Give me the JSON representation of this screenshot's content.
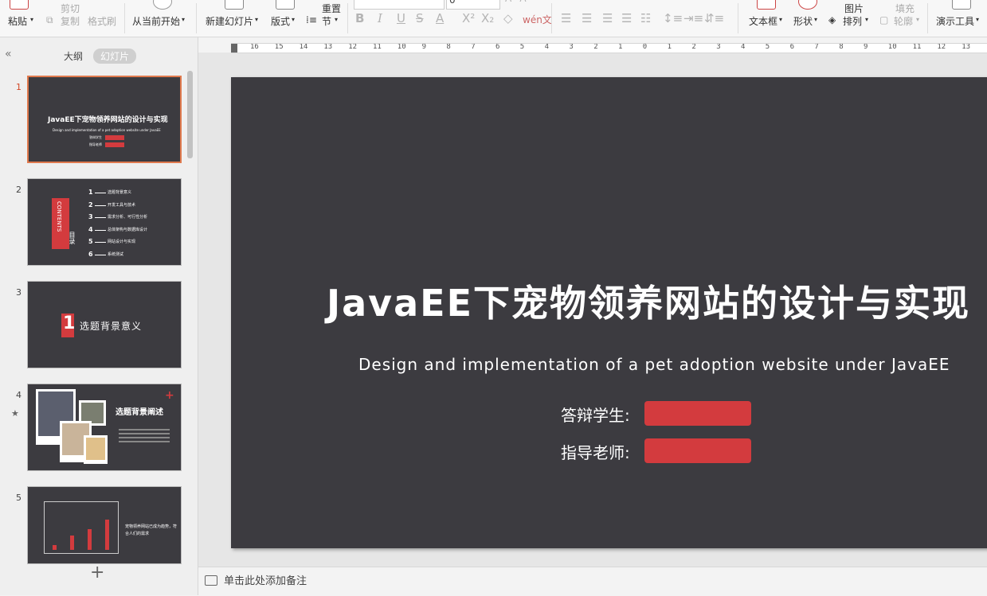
{
  "toolbar": {
    "paste": "粘贴",
    "cut": "剪切",
    "copy": "复制",
    "format_painter": "格式刷",
    "play_from_current": "从当前开始",
    "new_slide": "新建幻灯片",
    "layout": "版式",
    "reset": "重置",
    "section": "节",
    "font_size": "0",
    "text_box": "文本框",
    "shape": "形状",
    "arrange": "排列",
    "picture": "图片",
    "fill": "填充",
    "outline": "轮廓",
    "presentation_tools": "演示工具"
  },
  "panel": {
    "tab_outline": "大纲",
    "tab_slides": "幻灯片",
    "slide_numbers": [
      "1",
      "2",
      "3",
      "4",
      "5"
    ]
  },
  "thumbs": {
    "t1": {
      "title": "JavaEE下宠物领养网站的设计与实现",
      "sub": "Design and implementation of a pet adoption website under JavaEE",
      "label1": "答辩学生",
      "label2": "指导老师"
    },
    "t2": {
      "contents": "CONTENTS",
      "mulu": "目录",
      "items": [
        {
          "n": "1",
          "t": "选题背景意义"
        },
        {
          "n": "2",
          "t": "开发工具与技术"
        },
        {
          "n": "3",
          "t": "需求分析、可行性分析"
        },
        {
          "n": "4",
          "t": "总体架构与数据库设计"
        },
        {
          "n": "5",
          "t": "网站设计与实现"
        },
        {
          "n": "6",
          "t": "系统测试"
        }
      ]
    },
    "t3": {
      "num": "1",
      "title": "选题背景意义"
    },
    "t4": {
      "title": "选题背景阐述",
      "plus": "+",
      "star": "★"
    },
    "t5": {
      "text": "宠物领养网站已成为趋势，符合人们的需求"
    }
  },
  "ruler": {
    "labels": [
      "16",
      "15",
      "14",
      "13",
      "12",
      "11",
      "10",
      "9",
      "8",
      "7",
      "6",
      "5",
      "4",
      "3",
      "2",
      "1",
      "0",
      "1",
      "2",
      "3",
      "4",
      "5",
      "6",
      "7",
      "8",
      "9",
      "10",
      "11",
      "12",
      "13"
    ]
  },
  "slide": {
    "title": "JavaEE下宠物领养网站的设计与实现",
    "subtitle": "Design and implementation of a pet adoption website under JavaEE",
    "student_label": "答辩学生:",
    "teacher_label": "指导老师:",
    "bar_color": "#d33b3e",
    "bg_color": "#3c3b40"
  },
  "notes": {
    "placeholder": "单击此处添加备注"
  },
  "add_slide": "+",
  "collapse": "«"
}
